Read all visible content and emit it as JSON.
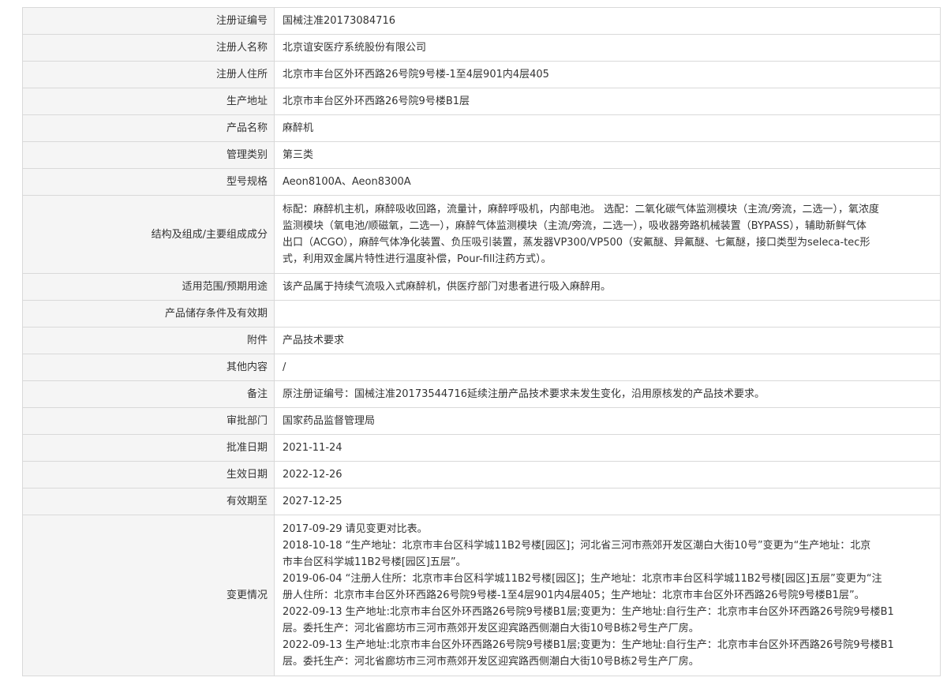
{
  "rows": [
    {
      "label": "注册证编号",
      "value": "国械注准20173084716"
    },
    {
      "label": "注册人名称",
      "value": "北京谊安医疗系统股份有限公司"
    },
    {
      "label": "注册人住所",
      "value": "北京市丰台区外环西路26号院9号楼-1至4层901内4层405"
    },
    {
      "label": "生产地址",
      "value": "北京市丰台区外环西路26号院9号楼B1层"
    },
    {
      "label": "产品名称",
      "value": "麻醉机"
    },
    {
      "label": "管理类别",
      "value": "第三类"
    },
    {
      "label": "型号规格",
      "value": "Aeon8100A、Aeon8300A"
    },
    {
      "label": "结构及组成/主要组成成分",
      "lines": [
        "标配：麻醉机主机，麻醉吸收回路，流量计，麻醉呼吸机，内部电池。 选配：二氧化碳气体监测模块（主流/旁流，二选一），氧浓度",
        "监测模块（氧电池/顺磁氧，二选一），麻醉气体监测模块（主流/旁流，二选一），吸收器旁路机械装置（BYPASS），辅助新鲜气体",
        "出口（ACGO），麻醉气体净化装置、负压吸引装置，蒸发器VP300/VP500（安氟醚、异氟醚、七氟醚，接口类型为seleca-tec形",
        "式，利用双金属片特性进行温度补偿，Pour-fill注药方式）。"
      ]
    },
    {
      "label": "适用范围/预期用途",
      "value": "该产品属于持续气流吸入式麻醉机，供医疗部门对患者进行吸入麻醉用。"
    },
    {
      "label": "产品储存条件及有效期",
      "value": ""
    },
    {
      "label": "附件",
      "value": "产品技术要求"
    },
    {
      "label": "其他内容",
      "value": "/"
    },
    {
      "label": "备注",
      "value": "原注册证编号：国械注准20173544716延续注册产品技术要求未发生变化，沿用原核发的产品技术要求。"
    },
    {
      "label": "审批部门",
      "value": "国家药品监督管理局"
    },
    {
      "label": "批准日期",
      "value": "2021-11-24"
    },
    {
      "label": "生效日期",
      "value": "2022-12-26"
    },
    {
      "label": "有效期至",
      "value": "2027-12-25"
    },
    {
      "label": "变更情况",
      "lines": [
        "2017-09-29 请见变更对比表。",
        "2018-10-18 “生产地址：北京市丰台区科学城11B2号楼[园区]；河北省三河市燕郊开发区潮白大街10号”变更为“生产地址：北京",
        "市丰台区科学城11B2号楼[园区]五层”。",
        "2019-06-04 “注册人住所：北京市丰台区科学城11B2号楼[园区]；生产地址：北京市丰台区科学城11B2号楼[园区]五层”变更为“注",
        "册人住所：北京市丰台区外环西路26号院9号楼-1至4层901内4层405；生产地址：北京市丰台区外环西路26号院9号楼B1层”。",
        "2022-09-13 生产地址:北京市丰台区外环西路26号院9号楼B1层;变更为：生产地址:自行生产：北京市丰台区外环西路26号院9号楼B1",
        "层。委托生产：河北省廊坊市三河市燕郊开发区迎宾路西侧潮白大街10号B栋2号生产厂房。",
        "2022-09-13 生产地址:北京市丰台区外环西路26号院9号楼B1层;变更为：生产地址:自行生产：北京市丰台区外环西路26号院9号楼B1",
        "层。委托生产：河北省廊坊市三河市燕郊开发区迎宾路西侧潮白大街10号B栋2号生产厂房。"
      ]
    }
  ]
}
